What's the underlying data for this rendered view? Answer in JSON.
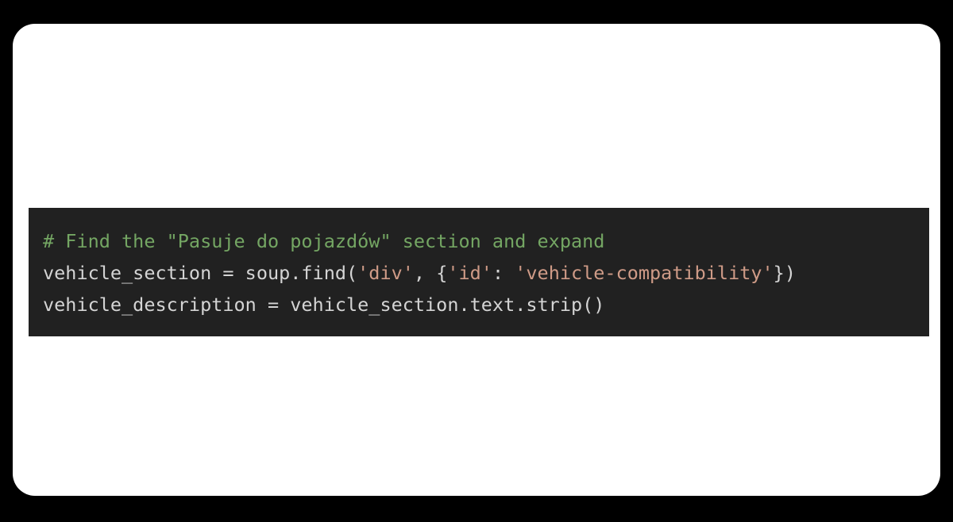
{
  "canvas": {
    "background_color": "#000000"
  },
  "card": {
    "background_color": "#ffffff",
    "corner_radius": "28px"
  },
  "code_block": {
    "background_color": "#212121",
    "language": "python",
    "default_text_color": "#d4d4d4",
    "comment_color": "#74a663",
    "string_color": "#cf9b87",
    "lines": [
      {
        "index": 1,
        "full_text": "# Find the \"Pasuje do pojazdów\" section and expand",
        "tokens": [
          {
            "text": "# Find the \"Pasuje do pojazdów\" section and expand",
            "type": "comment"
          }
        ]
      },
      {
        "index": 2,
        "full_text": "vehicle_section = soup.find('div', {'id': 'vehicle-compatibility'})",
        "tokens": [
          {
            "text": "vehicle_section = soup.find(",
            "type": "plain"
          },
          {
            "text": "'div'",
            "type": "string"
          },
          {
            "text": ", {",
            "type": "plain"
          },
          {
            "text": "'id'",
            "type": "string"
          },
          {
            "text": ": ",
            "type": "plain"
          },
          {
            "text": "'vehicle-compatibility'",
            "type": "string"
          },
          {
            "text": "})",
            "type": "plain"
          }
        ]
      },
      {
        "index": 3,
        "full_text": "vehicle_description = vehicle_section.text.strip()",
        "tokens": [
          {
            "text": "vehicle_description = vehicle_section.text.strip()",
            "type": "plain"
          }
        ]
      }
    ]
  }
}
